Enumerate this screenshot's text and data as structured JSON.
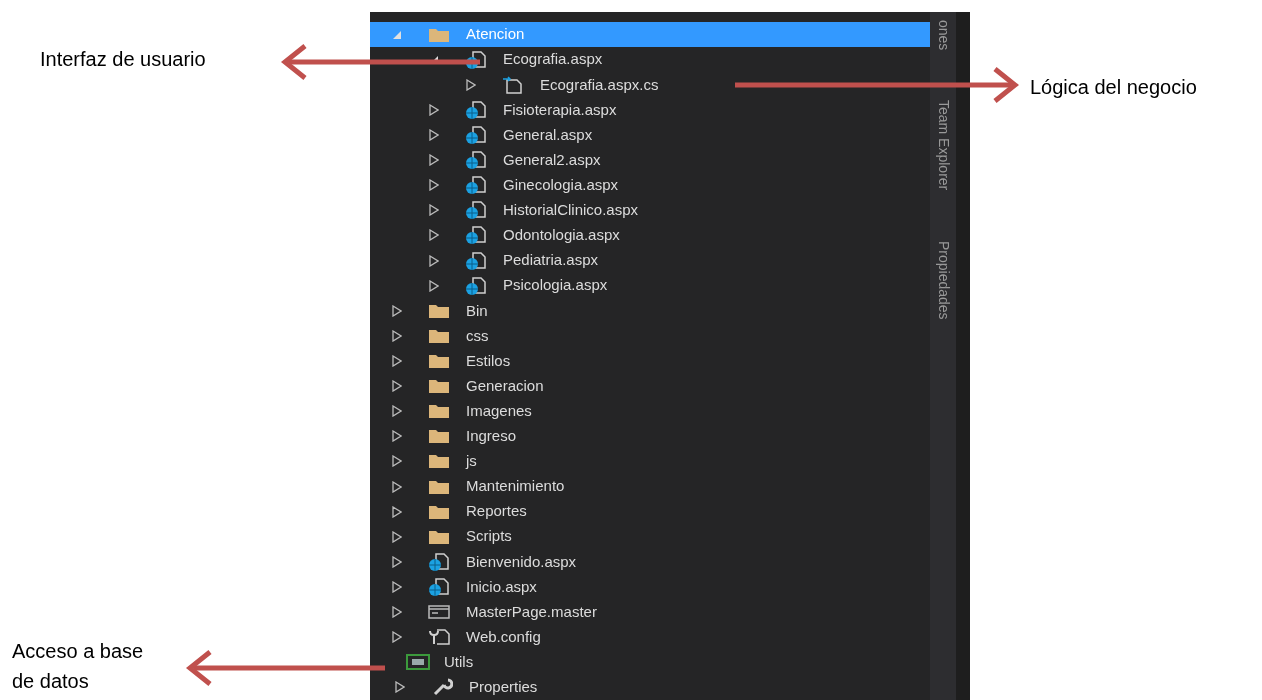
{
  "tree": [
    {
      "children": [
        {
          "label": "Atencion",
          "kind": "folder",
          "expanded": true,
          "selected": true,
          "children": [
            {
              "label": "Ecografia.aspx",
              "kind": "page",
              "expanded": true,
              "selected": false,
              "children": [
                {
                  "label": "Ecografia.aspx.cs",
                  "kind": "code",
                  "expanded": false,
                  "selected": false
                }
              ]
            },
            {
              "label": "Fisioterapia.aspx",
              "kind": "page",
              "expanded": false,
              "selected": false
            },
            {
              "label": "General.aspx",
              "kind": "page",
              "expanded": false,
              "selected": false
            },
            {
              "label": "General2.aspx",
              "kind": "page",
              "expanded": false,
              "selected": false
            },
            {
              "label": "Ginecologia.aspx",
              "kind": "page",
              "expanded": false,
              "selected": false
            },
            {
              "label": "HistorialClinico.aspx",
              "kind": "page",
              "expanded": false,
              "selected": false
            },
            {
              "label": "Odontologia.aspx",
              "kind": "page",
              "expanded": false,
              "selected": false
            },
            {
              "label": "Pediatria.aspx",
              "kind": "page",
              "expanded": false,
              "selected": false
            },
            {
              "label": "Psicologia.aspx",
              "kind": "page",
              "expanded": false,
              "selected": false
            }
          ]
        },
        {
          "label": "Bin",
          "kind": "folder",
          "expanded": false,
          "selected": false
        },
        {
          "label": "css",
          "kind": "folder",
          "expanded": false,
          "selected": false
        },
        {
          "label": "Estilos",
          "kind": "folder",
          "expanded": false,
          "selected": false
        },
        {
          "label": "Generacion",
          "kind": "folder",
          "expanded": false,
          "selected": false
        },
        {
          "label": "Imagenes",
          "kind": "folder",
          "expanded": false,
          "selected": false
        },
        {
          "label": "Ingreso",
          "kind": "folder",
          "expanded": false,
          "selected": false
        },
        {
          "label": "js",
          "kind": "folder",
          "expanded": false,
          "selected": false
        },
        {
          "label": "Mantenimiento",
          "kind": "folder",
          "expanded": false,
          "selected": false
        },
        {
          "label": "Reportes",
          "kind": "folder",
          "expanded": false,
          "selected": false
        },
        {
          "label": "Scripts",
          "kind": "folder",
          "expanded": false,
          "selected": false
        },
        {
          "label": "Bienvenido.aspx",
          "kind": "page",
          "expanded": false,
          "selected": false
        },
        {
          "label": "Inicio.aspx",
          "kind": "page",
          "expanded": false,
          "selected": false
        },
        {
          "label": "MasterPage.master",
          "kind": "master",
          "expanded": false,
          "selected": false
        },
        {
          "label": "Web.config",
          "kind": "config",
          "expanded": false,
          "selected": false
        }
      ]
    },
    {
      "label": "Utils",
      "kind": "project",
      "selected": false,
      "children": [
        {
          "label": "Properties",
          "kind": "properties",
          "expanded": false,
          "selected": false
        }
      ]
    }
  ],
  "side_tabs": [
    "ones",
    "Team Explorer",
    "Propiedades"
  ],
  "annotations": [
    {
      "text": "Interfaz de usuario",
      "kind": "left-arrow"
    },
    {
      "text": "Lógica del negocio",
      "kind": "right-arrow"
    },
    {
      "text": "Acceso a base de datos",
      "kind": "left-arrow"
    }
  ]
}
